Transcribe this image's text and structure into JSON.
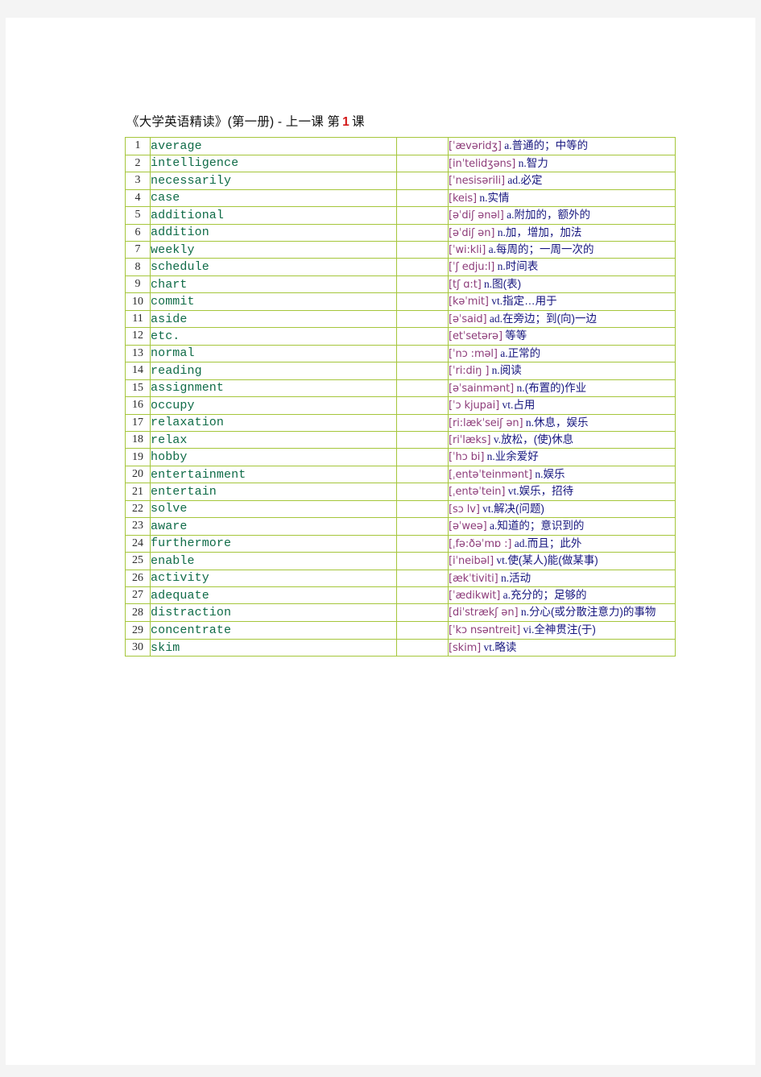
{
  "document": {
    "title_prefix": "《大学英语精读》(第一册) - 上一课 第",
    "lesson_number": "1",
    "title_suffix": "课",
    "colors": {
      "word": "#0f6b47",
      "phonetic": "#8e3d7a",
      "definition": "#16167e",
      "border": "#a5c63b",
      "lesson_number": "#d31818",
      "page_background": "#ffffff",
      "canvas_background": "#f4f4f4"
    }
  },
  "table": {
    "rows": [
      {
        "num": "1",
        "word": "average",
        "ipa": "[ˈævəridʒ]",
        "pos": "a.",
        "cn": "普通的；中等的"
      },
      {
        "num": "2",
        "word": "intelligence",
        "ipa": "[inˈtelidʒəns]",
        "pos": "n.",
        "cn": "智力"
      },
      {
        "num": "3",
        "word": "necessarily",
        "ipa": "[ˈnesisərili]",
        "pos": "ad.",
        "cn": "必定"
      },
      {
        "num": "4",
        "word": "case",
        "ipa": "[keis]",
        "pos": "n.",
        "cn": "实情"
      },
      {
        "num": "5",
        "word": "additional",
        "ipa": "[əˈdiʃ ənəl]",
        "pos": "a.",
        "cn": "附加的，额外的"
      },
      {
        "num": "6",
        "word": "addition",
        "ipa": "[əˈdiʃ ən]",
        "pos": "n.",
        "cn": "加，增加，加法"
      },
      {
        "num": "7",
        "word": "weekly",
        "ipa": "[ˈwi:kli]",
        "pos": "a.",
        "cn": "每周的；一周一次的"
      },
      {
        "num": "8",
        "word": "schedule",
        "ipa": "[ˈʃ edju:l]",
        "pos": "n.",
        "cn": "时间表"
      },
      {
        "num": "9",
        "word": "chart",
        "ipa": "[tʃ ɑ:t]",
        "pos": "n.",
        "cn": "图(表)"
      },
      {
        "num": "10",
        "word": "commit",
        "ipa": "[kəˈmit]",
        "pos": "vt.",
        "cn": "指定…用于"
      },
      {
        "num": "11",
        "word": "aside",
        "ipa": "[əˈsaid]",
        "pos": "ad.",
        "cn": "在旁边；到(向)一边"
      },
      {
        "num": "12",
        "word": "etc.",
        "ipa": "[etˈsetərə]",
        "pos": "",
        "cn": "等等"
      },
      {
        "num": "13",
        "word": "normal",
        "ipa": "[ˈnɔ :məl]",
        "pos": "a.",
        "cn": "正常的"
      },
      {
        "num": "14",
        "word": "reading",
        "ipa": "[ˈri:diŋ ]",
        "pos": "n.",
        "cn": "阅读"
      },
      {
        "num": "15",
        "word": "assignment",
        "ipa": "[əˈsainmənt]",
        "pos": "n.",
        "cn": "(布置的)作业"
      },
      {
        "num": "16",
        "word": "occupy",
        "ipa": "[ˈɔ kjupai]",
        "pos": "vt.",
        "cn": "占用"
      },
      {
        "num": "17",
        "word": "relaxation",
        "ipa": "[ri:lækˈseiʃ ən]",
        "pos": "n.",
        "cn": "休息，娱乐"
      },
      {
        "num": "18",
        "word": "relax",
        "ipa": "[riˈlæks]",
        "pos": "v.",
        "cn": "放松，(使)休息"
      },
      {
        "num": "19",
        "word": "hobby",
        "ipa": "[ˈhɔ bi]",
        "pos": "n.",
        "cn": "业余爱好"
      },
      {
        "num": "20",
        "word": "entertainment",
        "ipa": "[ˌentəˈteinmənt]",
        "pos": "n.",
        "cn": "娱乐"
      },
      {
        "num": "21",
        "word": "entertain",
        "ipa": "[ˌentəˈtein]",
        "pos": "vt.",
        "cn": "娱乐，招待"
      },
      {
        "num": "22",
        "word": "solve",
        "ipa": "[sɔ lv]",
        "pos": "vt.",
        "cn": "解决(问题)"
      },
      {
        "num": "23",
        "word": "aware",
        "ipa": "[əˈweə]",
        "pos": "a.",
        "cn": "知道的；意识到的"
      },
      {
        "num": "24",
        "word": "furthermore",
        "ipa": "[ˌfə:ðəˈmɒ :]",
        "pos": "ad.",
        "cn": "而且；此外"
      },
      {
        "num": "25",
        "word": "enable",
        "ipa": "[iˈneibəl]",
        "pos": "vt.",
        "cn": "使(某人)能(做某事)"
      },
      {
        "num": "26",
        "word": "activity",
        "ipa": "[ækˈtiviti]",
        "pos": "n.",
        "cn": "活动"
      },
      {
        "num": "27",
        "word": "adequate",
        "ipa": "[ˈædikwit]",
        "pos": "a.",
        "cn": "充分的；足够的"
      },
      {
        "num": "28",
        "word": "distraction",
        "ipa": "[diˈstrækʃ ən]",
        "pos": "n.",
        "cn": "分心(或分散注意力)的事物"
      },
      {
        "num": "29",
        "word": "concentrate",
        "ipa": "[ˈkɔ nsəntreit]",
        "pos": "vi.",
        "cn": "全神贯注(于)"
      },
      {
        "num": "30",
        "word": "skim",
        "ipa": "[skim]",
        "pos": "vt.",
        "cn": "略读"
      }
    ]
  }
}
